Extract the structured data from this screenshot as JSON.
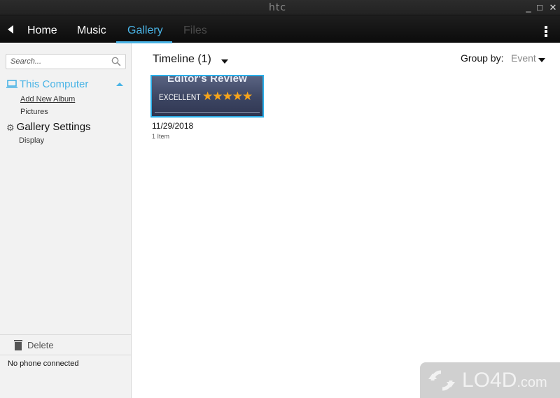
{
  "window": {
    "title": "htc",
    "controls": {
      "minimize": "_",
      "maximize": "□",
      "close": "✕"
    }
  },
  "nav": {
    "back_icon": "back-arrow-icon",
    "tabs": [
      {
        "label": "Home",
        "state": "normal"
      },
      {
        "label": "Music",
        "state": "normal"
      },
      {
        "label": "Gallery",
        "state": "active"
      },
      {
        "label": "Files",
        "state": "disabled"
      }
    ],
    "more_icon": "vertical-dots-icon",
    "accent_color": "#4ab4e6"
  },
  "sidebar": {
    "search": {
      "placeholder": "Search...",
      "value": ""
    },
    "sections": [
      {
        "label": "This Computer",
        "icon": "laptop-icon",
        "expanded": true,
        "items": [
          {
            "label": "Add New Album"
          },
          {
            "label": "Pictures"
          }
        ]
      },
      {
        "label": "Gallery Settings",
        "icon": "gear-icon",
        "items": [
          {
            "label": "Display"
          }
        ]
      }
    ],
    "delete_label": "Delete",
    "phone_status": "No phone connected"
  },
  "main": {
    "timeline_label": "Timeline (1)",
    "group_by_label": "Group by:",
    "group_by_value": "Event",
    "albums": [
      {
        "thumbnail_title": "Editor's Review",
        "thumbnail_badge": "EXCELLENT",
        "thumbnail_stars": "★★★★★",
        "date": "11/29/2018",
        "count": "1 Item"
      }
    ]
  },
  "watermark": {
    "brand": "LO4D",
    "suffix": ".com"
  }
}
